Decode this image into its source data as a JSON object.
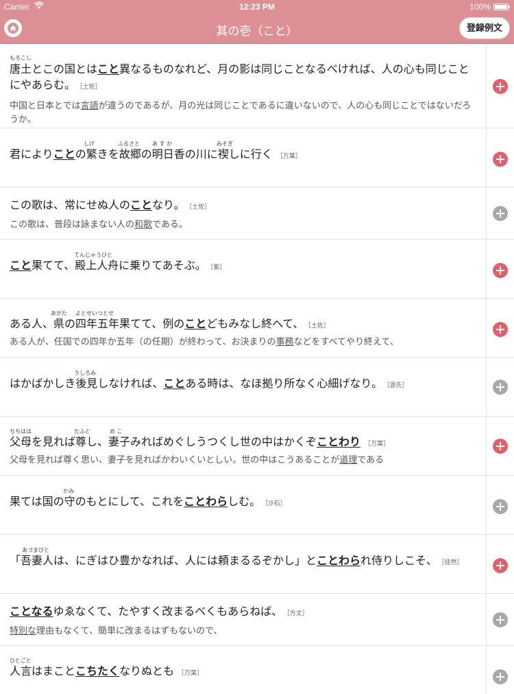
{
  "status": {
    "carrier": "Carrier",
    "time": "12:23 PM",
    "battery": "100%"
  },
  "nav": {
    "title": "其の壱（こと）",
    "register_label": "登録例文"
  },
  "colors": {
    "header": "#dc8f94",
    "added": "#e0606b",
    "not_added": "#a8a8a8"
  },
  "items": [
    {
      "rubies": [
        {
          "text": "もろこし"
        }
      ],
      "jp": [
        "唐土とこの国とは",
        "こと",
        "異なるものなれど、月の影は同じことなるべければ、人の心も同じことにやあらむ。"
      ],
      "source": "［土佐］",
      "trans": [
        "中国と日本とでは",
        "言語",
        "が違うのであるが、月の光は同じことであるに違いないので、人の心も同じことではないだろうか。"
      ],
      "icon": "add-circle-red-icon"
    },
    {
      "rubies": [
        {
          "text": "しげ"
        },
        {
          "text": "ふるさと"
        },
        {
          "text": "あ す か"
        },
        {
          "text": "みそぎ"
        }
      ],
      "jp": [
        "君により",
        "こと",
        "の繁きを故郷の明日香の川に禊しに行く"
      ],
      "source": "［万葉］",
      "trans": null,
      "icon": "add-circle-red-icon"
    },
    {
      "rubies": [],
      "jp": [
        "この歌は、常にせぬ人の",
        "こと",
        "なり。"
      ],
      "source": "［土佐］",
      "trans": [
        "この歌は、普段は詠まない人の",
        "和歌",
        "である。"
      ],
      "icon": "add-circle-gray-icon"
    },
    {
      "rubies": [
        {
          "text": "てんじゃうびと"
        }
      ],
      "jp": [
        "",
        "こと",
        "果てて、殿上人舟に乗りてあそぶ。"
      ],
      "source": "［紫］",
      "trans": null,
      "icon": "add-circle-red-icon"
    },
    {
      "rubies": [
        {
          "text": "あがた"
        },
        {
          "text": "よとせいつとせ"
        }
      ],
      "jp": [
        "ある人、県の四年五年果てて、例の",
        "こと",
        "どもみなし終へて、"
      ],
      "source": "［土佐］",
      "trans": [
        "ある人が、任国での四年か五年（の任期）が終わって、お決まりの",
        "事務",
        "などをすべてやり終えて、"
      ],
      "icon": "add-circle-red-icon"
    },
    {
      "rubies": [
        {
          "text": "うしろみ"
        }
      ],
      "jp": [
        "はかばかしき後見しなければ、",
        "こと",
        "ある時は、なほ拠り所なく心細げなり。"
      ],
      "source": "［源氏］",
      "trans": null,
      "icon": "add-circle-gray-icon"
    },
    {
      "rubies": [
        {
          "text": "ちちはは"
        },
        {
          "text": "たふと"
        },
        {
          "text": "め こ"
        }
      ],
      "jp": [
        "父母を見れば尊し、妻子みればめぐしうつくし世の中はかくぞ",
        "ことわり",
        ""
      ],
      "source": "［万葉］",
      "trans": [
        "父母を見れば尊く思い、妻子を見ればかわいくいとしい。世の中はこうあることが",
        "道理",
        "である"
      ],
      "icon": "add-circle-red-icon"
    },
    {
      "rubies": [
        {
          "text": "かみ"
        }
      ],
      "jp": [
        "果ては国の守のもとにして、これを",
        "ことわら",
        "しむ。"
      ],
      "source": "［沙石］",
      "trans": null,
      "icon": "add-circle-gray-icon"
    },
    {
      "rubies": [
        {
          "text": "あづまびと"
        }
      ],
      "jp": [
        "「吾妻人は、にぎはひ豊かなれば、人には頼まるるぞかし」と",
        "ことわら",
        "れ侍りしこそ、"
      ],
      "source": "［徒然］",
      "trans": null,
      "icon": "add-circle-red-icon"
    },
    {
      "rubies": [],
      "jp": [
        "",
        "ことなる",
        "ゆゑなくて、たやすく改まるべくもあらねば、"
      ],
      "source": "［方丈］",
      "trans": [
        "",
        "特別な",
        "理由もなくて、簡単に改まるはずもないので、"
      ],
      "icon": "add-circle-gray-icon"
    },
    {
      "rubies": [
        {
          "text": "ひとごと"
        }
      ],
      "jp": [
        "人言はまこと",
        "こちたく",
        "なりぬとも"
      ],
      "source": "［万葉］",
      "trans": null,
      "icon": "add-circle-gray-icon"
    }
  ]
}
